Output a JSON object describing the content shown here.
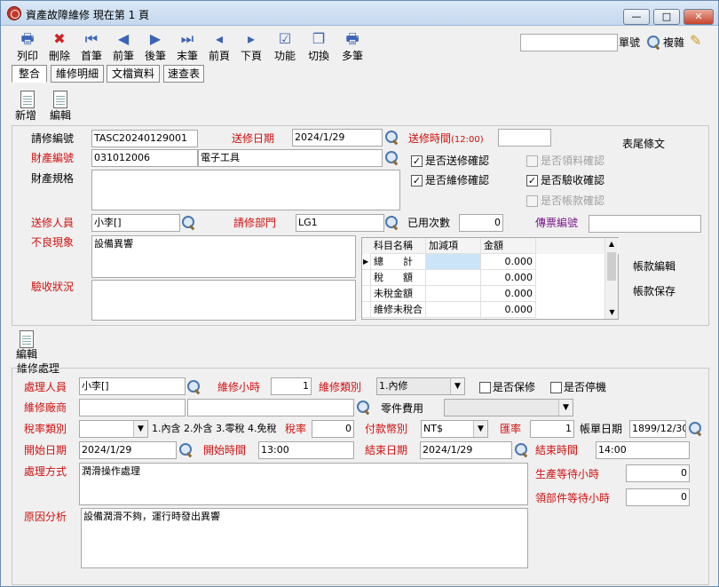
{
  "window": {
    "title": "資產故障維修  現在第 1 頁",
    "btn_min": "—",
    "btn_max": "□",
    "btn_close": "✕"
  },
  "toolbar": [
    {
      "label": "列印",
      "icon": "printer-icon",
      "glyph": "🖶"
    },
    {
      "label": "刪除",
      "icon": "delete-icon",
      "glyph": "✖"
    },
    {
      "label": "首筆",
      "icon": "first-record-icon",
      "glyph": "⏮"
    },
    {
      "label": "前筆",
      "icon": "prev-record-icon",
      "glyph": "◀"
    },
    {
      "label": "後筆",
      "icon": "next-record-icon",
      "glyph": "▶"
    },
    {
      "label": "末筆",
      "icon": "last-record-icon",
      "glyph": "⏭"
    },
    {
      "label": "前頁",
      "icon": "prev-page-icon",
      "glyph": "◂"
    },
    {
      "label": "下頁",
      "icon": "next-page-icon",
      "glyph": "▸"
    },
    {
      "label": "功能",
      "icon": "function-icon",
      "glyph": "☑"
    },
    {
      "label": "切換",
      "icon": "switch-icon",
      "glyph": "❐"
    },
    {
      "label": "多筆",
      "icon": "multi-record-icon",
      "glyph": "🖶"
    }
  ],
  "search": {
    "value": "",
    "label": "單號",
    "copy_label": "複雜"
  },
  "tabs": [
    "整合",
    "維修明細",
    "文檔資料",
    "速查表"
  ],
  "actions": {
    "new_label": "新增",
    "edit_label": "編輯"
  },
  "form": {
    "request_no_label": "請修編號",
    "request_no": "TASC20240129001",
    "send_date_label": "送修日期",
    "send_date": "2024/1/29",
    "send_time_label": "送修時間",
    "send_time_sub": "(12:00)",
    "send_time": "",
    "tail_label": "表尾條文",
    "asset_no_label": "財產編號",
    "asset_no": "031012006",
    "asset_name": "電子工具",
    "spec_label": "財產規格",
    "spec": "",
    "chk_sent": "是否送修確認",
    "chk_repair": "是否維修確認",
    "chk_material": "是否領料確認",
    "chk_accept": "是否驗收確認",
    "chk_account": "是否帳款確認",
    "sender_label": "送修人員",
    "sender": "小李[]",
    "dept_label": "請修部門",
    "dept": "LG1",
    "used_label": "已用次數",
    "used": "0",
    "voucher_label": "傳票編號",
    "voucher": "",
    "symptom_label": "不良現象",
    "symptom": "設備異響",
    "accept_label": "驗收狀況",
    "accept": "",
    "account_edit": "帳款編輯",
    "account_save": "帳款保存"
  },
  "grid": {
    "headers": [
      "科目名稱",
      "加減項",
      "金額"
    ],
    "rows": [
      {
        "name": "總　　計",
        "plus": "",
        "amount": "0.000"
      },
      {
        "name": "稅　　額",
        "plus": "",
        "amount": "0.000"
      },
      {
        "name": "未稅金額",
        "plus": "",
        "amount": "0.000"
      },
      {
        "name": "維修未稅合",
        "plus": "",
        "amount": "0.000"
      }
    ]
  },
  "repair": {
    "edit_label": "編輯",
    "section_label": "維修處理",
    "handler_label": "處理人員",
    "handler": "小李[]",
    "hours_label": "維修小時",
    "hours": "1",
    "type_label": "維修類別",
    "type": "1.內修",
    "chk_warranty": "是否保修",
    "chk_stop": "是否停機",
    "vendor_label": "維修廠商",
    "vendor": "",
    "vendor_name": "",
    "parts_label": "零件費用",
    "parts": "",
    "tax_type_label": "稅率類別",
    "tax_type": "",
    "tax_note": "1.內含 2.外含 3.零稅 4.免稅",
    "tax_rate_label": "稅率",
    "tax_rate": "0",
    "currency_label": "付款幣別",
    "currency": "NT$",
    "rate_label": "匯率",
    "rate": "1",
    "bill_date_label": "帳單日期",
    "bill_date": "1899/12/30",
    "start_date_label": "開始日期",
    "start_date": "2024/1/29",
    "start_time_label": "開始時間",
    "start_time": "13:00",
    "end_date_label": "結束日期",
    "end_date": "2024/1/29",
    "end_time_label": "結束時間",
    "end_time": "14:00",
    "method_label": "處理方式",
    "method": "潤滑操作處理",
    "wait_prod_label": "生產等待小時",
    "wait_prod": "0",
    "wait_parts_label": "領部件等待小時",
    "wait_parts": "0",
    "cause_label": "原因分析",
    "cause": "設備潤滑不夠，運行時發出異響"
  }
}
